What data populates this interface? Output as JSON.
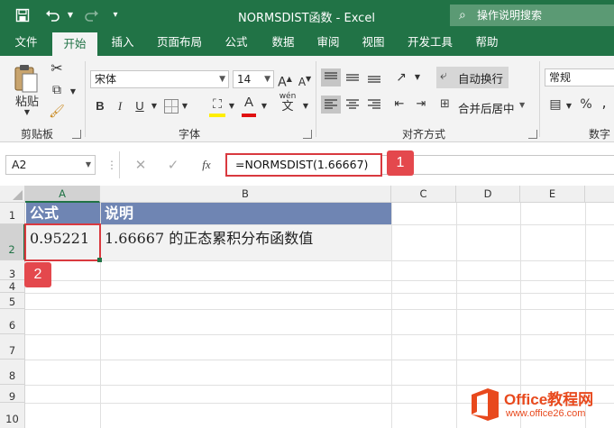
{
  "window": {
    "title": "NORMSDIST函数 - Excel"
  },
  "tell_me": {
    "label": "操作说明搜索"
  },
  "tabs": [
    "文件",
    "开始",
    "插入",
    "页面布局",
    "公式",
    "数据",
    "审阅",
    "视图",
    "开发工具",
    "帮助"
  ],
  "ribbon": {
    "clipboard": {
      "paste": "粘贴",
      "label": "剪贴板"
    },
    "font": {
      "name": "宋体",
      "size": "14",
      "label": "字体",
      "bold": "B",
      "italic": "I",
      "underline": "U",
      "color_letter": "A",
      "phonetic": "wén",
      "phonetic_char": "文"
    },
    "alignment": {
      "wrap": "自动换行",
      "merge": "合并后居中",
      "label": "对齐方式"
    },
    "number": {
      "format": "常规",
      "percent": "%",
      "comma": ",",
      "label": "数字"
    }
  },
  "formula_bar": {
    "name_box": "A2",
    "fx": "fx",
    "formula": "=NORMSDIST(1.66667)"
  },
  "columns": [
    "A",
    "B",
    "C",
    "D",
    "E"
  ],
  "rows": [
    "1",
    "2",
    "3",
    "4",
    "5",
    "6",
    "7",
    "8",
    "9",
    "10"
  ],
  "cells": {
    "a1": "公式",
    "b1": "说明",
    "a2": "0.95221",
    "b2": "1.66667 的正态累积分布函数值"
  },
  "callouts": {
    "one": "1",
    "two": "2"
  },
  "watermark": {
    "brand": "Office教程网",
    "url": "www.office26.com"
  },
  "colors": {
    "excel_green": "#217346",
    "header_fill": "#6f85b3",
    "callout_red": "#e4484d",
    "logo_orange": "#e8491d"
  }
}
